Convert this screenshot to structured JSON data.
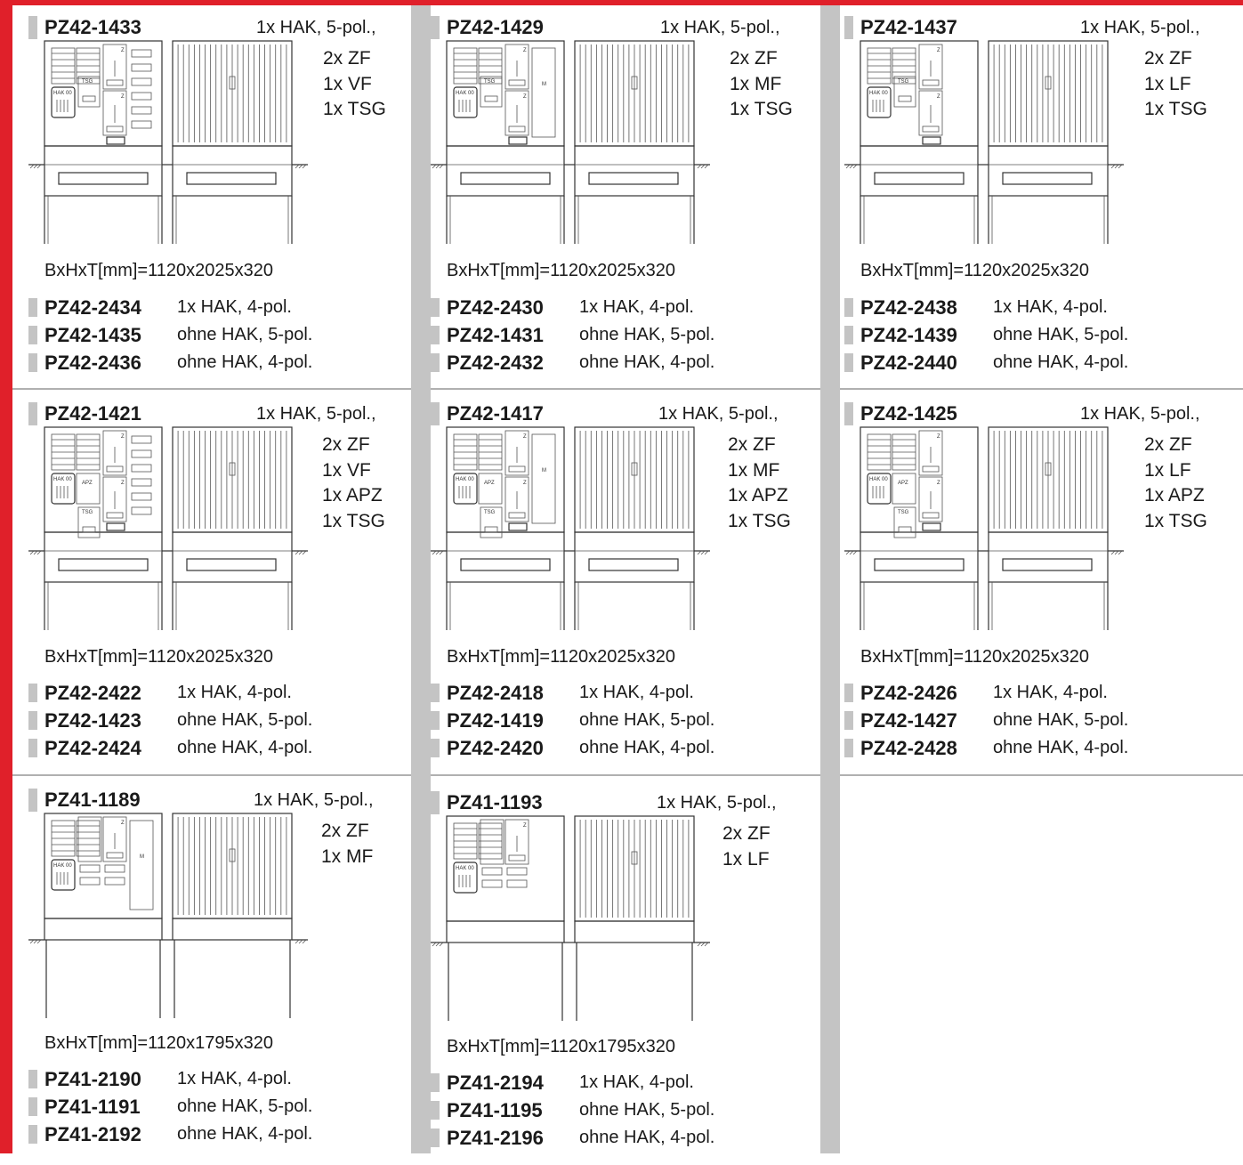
{
  "cells": [
    {
      "title": "PZ42-1433",
      "hak": "1x HAK, 5-pol.,",
      "features": [
        "2x ZF",
        "1x VF",
        "1x TSG"
      ],
      "dims": "BxHxT[mm]=1120x2025x320",
      "variants": [
        {
          "code": "PZ42-2434",
          "desc": "1x HAK, 4-pol."
        },
        {
          "code": "PZ42-1435",
          "desc": "ohne HAK, 5-pol."
        },
        {
          "code": "PZ42-2436",
          "desc": "ohne HAK, 4-pol."
        }
      ]
    },
    {
      "title": "PZ42-1429",
      "hak": "1x HAK, 5-pol.,",
      "features": [
        "2x ZF",
        "1x MF",
        "1x TSG"
      ],
      "dims": "BxHxT[mm]=1120x2025x320",
      "variants": [
        {
          "code": "PZ42-2430",
          "desc": "1x HAK, 4-pol."
        },
        {
          "code": "PZ42-1431",
          "desc": "ohne HAK, 5-pol."
        },
        {
          "code": "PZ42-2432",
          "desc": "ohne HAK, 4-pol."
        }
      ]
    },
    {
      "title": "PZ42-1437",
      "hak": "1x HAK, 5-pol.,",
      "features": [
        "2x ZF",
        "1x LF",
        "1x TSG"
      ],
      "dims": "BxHxT[mm]=1120x2025x320",
      "variants": [
        {
          "code": "PZ42-2438",
          "desc": "1x HAK, 4-pol."
        },
        {
          "code": "PZ42-1439",
          "desc": "ohne HAK, 5-pol."
        },
        {
          "code": "PZ42-2440",
          "desc": "ohne HAK, 4-pol."
        }
      ]
    },
    {
      "title": "PZ42-1421",
      "hak": "1x HAK, 5-pol.,",
      "features": [
        "2x ZF",
        "1x VF",
        "1x APZ",
        "1x TSG"
      ],
      "dims": "BxHxT[mm]=1120x2025x320",
      "variants": [
        {
          "code": "PZ42-2422",
          "desc": "1x HAK, 4-pol."
        },
        {
          "code": "PZ42-1423",
          "desc": "ohne HAK, 5-pol."
        },
        {
          "code": "PZ42-2424",
          "desc": "ohne HAK, 4-pol."
        }
      ]
    },
    {
      "title": "PZ42-1417",
      "hak": "1x HAK, 5-pol.,",
      "features": [
        "2x ZF",
        "1x MF",
        "1x APZ",
        "1x TSG"
      ],
      "dims": "BxHxT[mm]=1120x2025x320",
      "variants": [
        {
          "code": "PZ42-2418",
          "desc": "1x HAK, 4-pol."
        },
        {
          "code": "PZ42-1419",
          "desc": "ohne HAK, 5-pol."
        },
        {
          "code": "PZ42-2420",
          "desc": "ohne HAK, 4-pol."
        }
      ]
    },
    {
      "title": "PZ42-1425",
      "hak": "1x HAK, 5-pol.,",
      "features": [
        "2x ZF",
        "1x LF",
        "1x APZ",
        "1x TSG"
      ],
      "dims": "BxHxT[mm]=1120x2025x320",
      "variants": [
        {
          "code": "PZ42-2426",
          "desc": "1x HAK, 4-pol."
        },
        {
          "code": "PZ42-1427",
          "desc": "ohne HAK, 5-pol."
        },
        {
          "code": "PZ42-2428",
          "desc": "ohne HAK, 4-pol."
        }
      ]
    },
    {
      "title": "PZ41-1189",
      "hak": "1x HAK, 5-pol.,",
      "features": [
        "2x ZF",
        "1x MF"
      ],
      "dims": "BxHxT[mm]=1120x1795x320",
      "variants": [
        {
          "code": "PZ41-2190",
          "desc": "1x HAK, 4-pol."
        },
        {
          "code": "PZ41-1191",
          "desc": "ohne HAK, 5-pol."
        },
        {
          "code": "PZ41-2192",
          "desc": "ohne HAK, 4-pol."
        }
      ]
    },
    {
      "title": "PZ41-1193",
      "hak": "1x HAK, 5-pol.,",
      "features": [
        "2x ZF",
        "1x LF"
      ],
      "dims": "BxHxT[mm]=1120x1795x320",
      "variants": [
        {
          "code": "PZ41-2194",
          "desc": "1x HAK, 4-pol."
        },
        {
          "code": "PZ41-1195",
          "desc": "ohne HAK, 5-pol."
        },
        {
          "code": "PZ41-2196",
          "desc": "ohne HAK, 4-pol."
        }
      ]
    }
  ],
  "drawing_labels": {
    "hak": "HAK 00",
    "tsg": "TSG",
    "apz": "APZ",
    "m": "M",
    "z": "Z"
  },
  "colors": {
    "accent": "#e0202a",
    "separator": "#c4c4c4"
  }
}
